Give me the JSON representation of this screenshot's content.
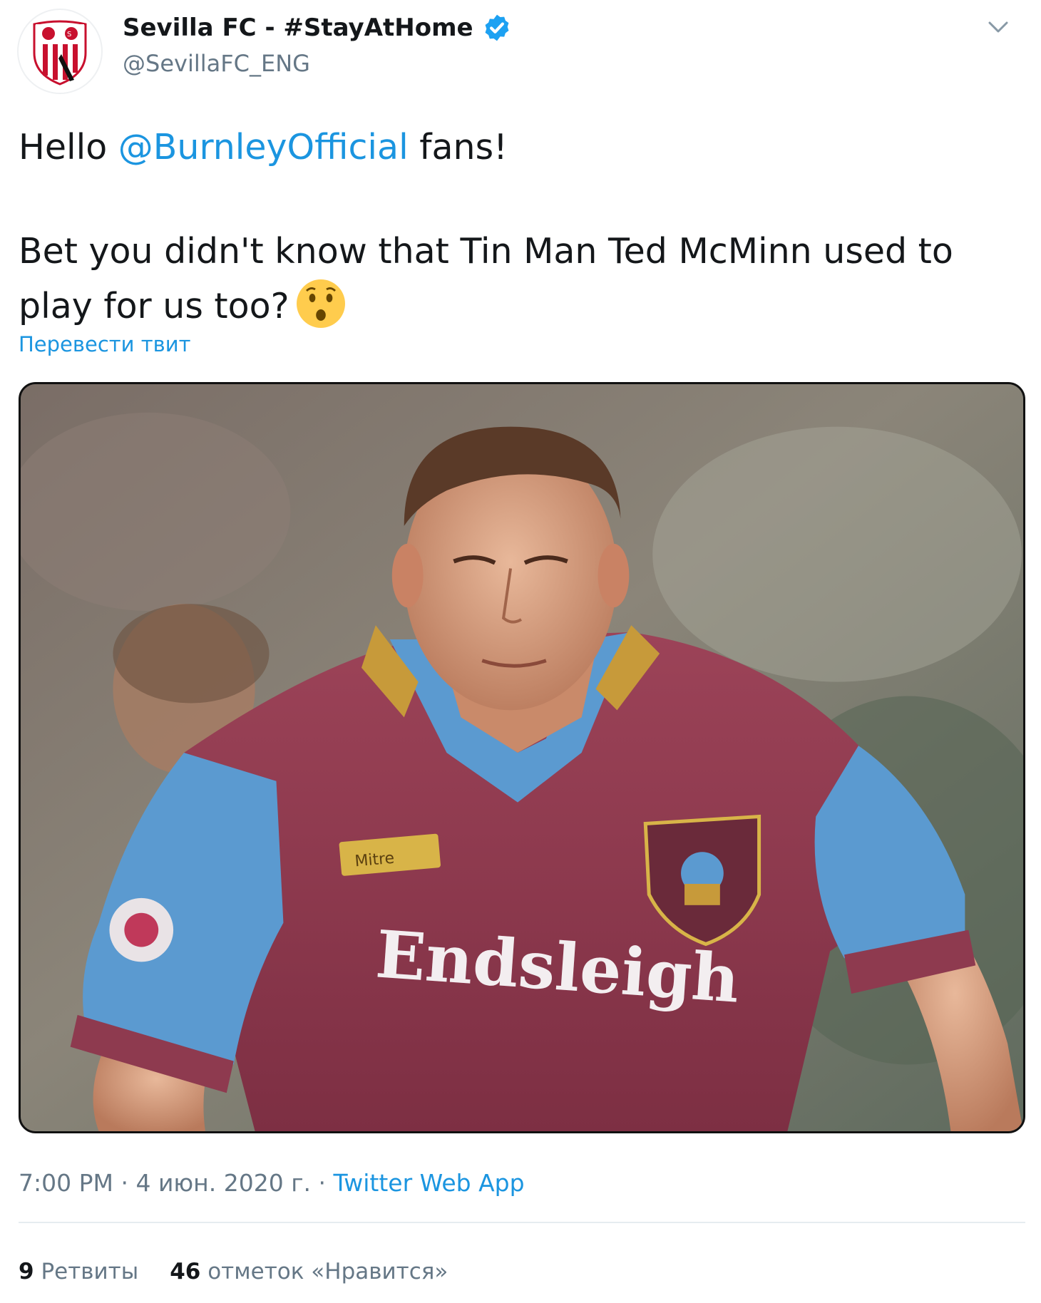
{
  "author": {
    "name": "Sevilla FC - #StayAtHome",
    "handle": "@SevillaFC_ENG",
    "verified": true,
    "avatar_icon": "sevilla-crest-icon"
  },
  "tweet": {
    "line1_prefix": "Hello ",
    "mention": "@BurnleyOfficial",
    "line1_suffix": " fans!",
    "line2": "Bet you didn't know that Tin Man Ted McMinn used to",
    "line3": "play for us too?",
    "emoji": "hushed-face-emoji",
    "translate_link": "Перевести твит"
  },
  "media": {
    "photo_text": "Endsleigh",
    "sleeve_brand": "Mitre"
  },
  "meta": {
    "time": "7:00 PM",
    "separator": "·",
    "date": "4 июн. 2020 г.",
    "source": "Twitter Web App"
  },
  "stats": {
    "retweets_count": "9",
    "retweets_label": "Ретвиты",
    "likes_count": "46",
    "likes_label": "отметок «Нравится»"
  },
  "colors": {
    "link": "#1b95e0",
    "text": "#14171a",
    "secondary": "#657786",
    "shirt_claret": "#8e3a4f",
    "shirt_blue": "#5b9ad0"
  }
}
